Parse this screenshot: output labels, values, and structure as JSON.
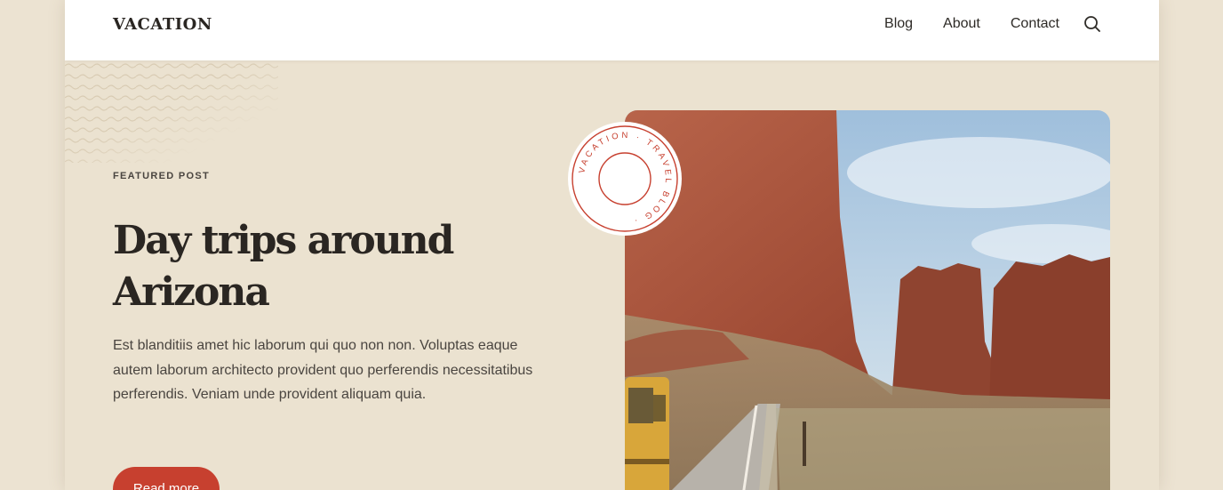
{
  "header": {
    "logo": "VACATION",
    "nav": [
      "Blog",
      "About",
      "Contact"
    ],
    "search_icon": "search-icon"
  },
  "featured": {
    "kicker": "FEATURED POST",
    "title": "Day trips around Arizona",
    "excerpt": "Est blanditiis amet hic laborum qui quo non non. Voluptas eaque autem laborum architecto provident quo perferendis necessitatibus perferendis. Veniam unde provident aliquam quia.",
    "button": "Read more"
  },
  "badge": {
    "text": "VACATION · TRAVEL BLOG ·"
  },
  "colors": {
    "background": "#ebe2d0",
    "accent": "#c7402f",
    "text": "#2a2622"
  }
}
